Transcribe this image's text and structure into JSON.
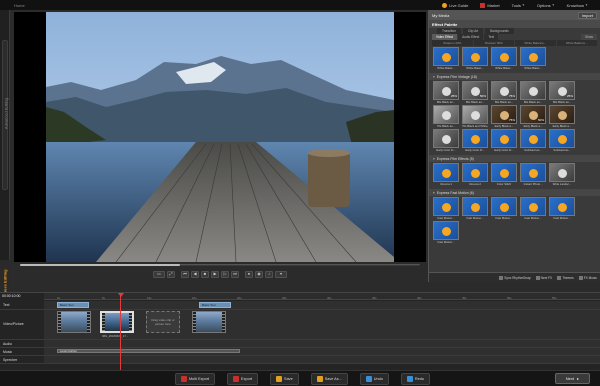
{
  "topbar": {
    "home": "Home",
    "live_guide": "Live Guide",
    "market": "Market",
    "tools": "Tools",
    "options": "Options",
    "knowhow": "Knowhow"
  },
  "leftstrip": {
    "advanced": "Advanced Editing",
    "express": "Express Editing"
  },
  "right_panel": {
    "media_title": "My Media",
    "import_label": "Import",
    "palette_title": "Effect Palette",
    "tabs": [
      "Transition",
      "Clip Art",
      "Backgrounds"
    ],
    "subtabs": [
      "Video Effect",
      "Audio Effect",
      "Text",
      "Show"
    ],
    "name_strip": [
      "Sharpen 20%",
      "Sharpen 50%",
      "White Balance...",
      "White Balance..."
    ],
    "sections": {
      "white_balance": {
        "items": [
          "White Balan...",
          "White Balan...",
          "White Balan...",
          "White Balan..."
        ]
      },
      "vintage": {
        "title": "Express Film Vintage (18)",
        "items": [
          "80s Black an...",
          "80s Black an...",
          "80s Black an...",
          "80s Black an...",
          "80s Black an...",
          "70s Black an...",
          "70s Black and White, Film",
          "Early Black a...",
          "Early Black a...",
          "Early Black a...",
          "Early Color Fi...",
          "Early Color Fi...",
          "Early Color Fi...",
          "Subdued an...",
          "Subdued an..."
        ],
        "percents": [
          "25%",
          "50%",
          "75%",
          "25%",
          "75%",
          "50%"
        ]
      },
      "film_effects": {
        "title": "Express Film Effects (5)",
        "items": [
          "Cinema 1",
          "Cinema 2",
          "Color Stitch",
          "Instant Photo...",
          "Wide Landsc..."
        ]
      },
      "fast_motion": {
        "title": "Express Fast Motion (6)",
        "items": [
          "Fast Motion...",
          "Fast Motion...",
          "Fast Motion...",
          "Fast Motion...",
          "Fast Motion...",
          "Fast Motion..."
        ]
      }
    },
    "bottom": {
      "rhythm": "Sync RhythmSnap",
      "next_fx": "Next FX",
      "themes": "Themes",
      "fx_music": "FX Music"
    }
  },
  "preview": {
    "progress": 0.4
  },
  "timeline": {
    "timecode": "00:00:10:00",
    "ticks": [
      "0s",
      "5s",
      "10s",
      "15s",
      "20s",
      "25s",
      "30s",
      "35s",
      "40s",
      "45s",
      "50s",
      "55s"
    ],
    "tracks": [
      "Text",
      "Video/Picture",
      "Audio",
      "Music",
      "Sprecher"
    ],
    "text_clips": [
      "Basic Text",
      "Basic Text"
    ],
    "clip_label": "IMG_20180603_17...",
    "placeholder": "Drag video clip or picture here",
    "music_clip": "Lando Rather"
  },
  "bottombar": {
    "multi_export": "Multi Export",
    "export": "Export",
    "save": "Save",
    "save_as": "Save As...",
    "undo": "Undo",
    "redo": "Redo",
    "next": "Next"
  }
}
